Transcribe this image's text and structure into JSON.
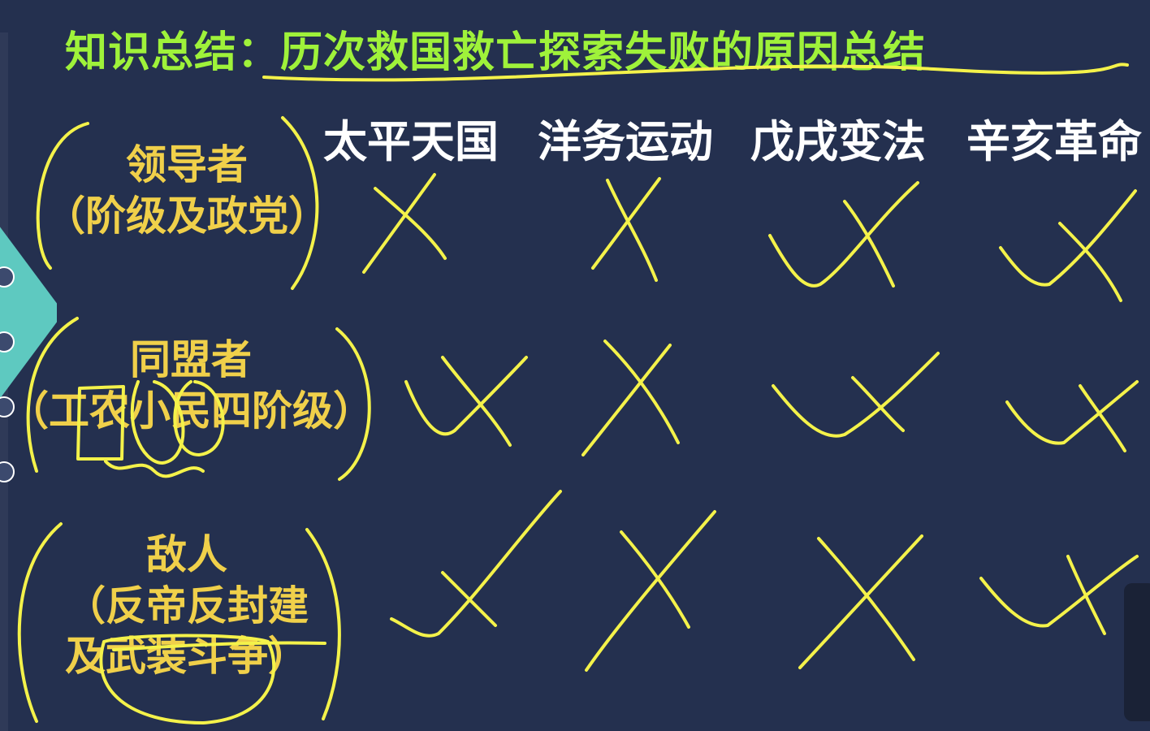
{
  "title": "知识总结：历次救国救亡探索失败的原因总结",
  "columns": [
    "太平天国",
    "洋务运动",
    "戊戌变法",
    "辛亥革命"
  ],
  "rows": [
    {
      "label_lines": [
        "领导者",
        "（阶级及政党）"
      ]
    },
    {
      "label_lines": [
        "同盟者",
        "（工农小民四阶级）"
      ]
    },
    {
      "label_lines": [
        "敌人",
        "（反帝反封建",
        "及武装斗争）"
      ]
    }
  ],
  "colors": {
    "background": "#24304f",
    "title": "#9ff23a",
    "column_header": "#ffffff",
    "row_label": "#f0d04a",
    "annotation_ink": "#f4f24a"
  },
  "marks": [
    [
      "cross",
      "cross",
      "check-cross",
      "check-cross"
    ],
    [
      "check-cross",
      "cross",
      "check-cross",
      "check-cross"
    ],
    [
      "check-cross",
      "cross",
      "cross",
      "check-cross"
    ]
  ]
}
